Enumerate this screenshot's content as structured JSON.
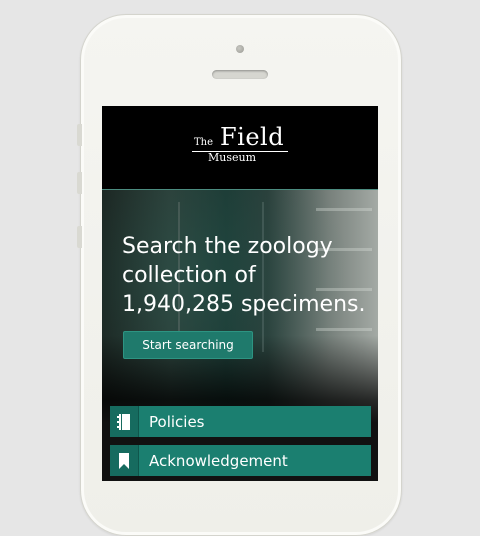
{
  "logo": {
    "the": "The",
    "field": "Field",
    "museum": "Museum"
  },
  "hero": {
    "headline": "Search the zoology collection of 1,940,285 specimens.",
    "cta_label": "Start searching"
  },
  "menu": {
    "items": [
      {
        "label": "Policies",
        "icon": "notebook-icon"
      },
      {
        "label": "Acknowledgement",
        "icon": "bookmark-icon"
      }
    ]
  },
  "colors": {
    "accent": "#1b7f70",
    "background": "#e6e6e6",
    "device": "#f3f3ef"
  }
}
